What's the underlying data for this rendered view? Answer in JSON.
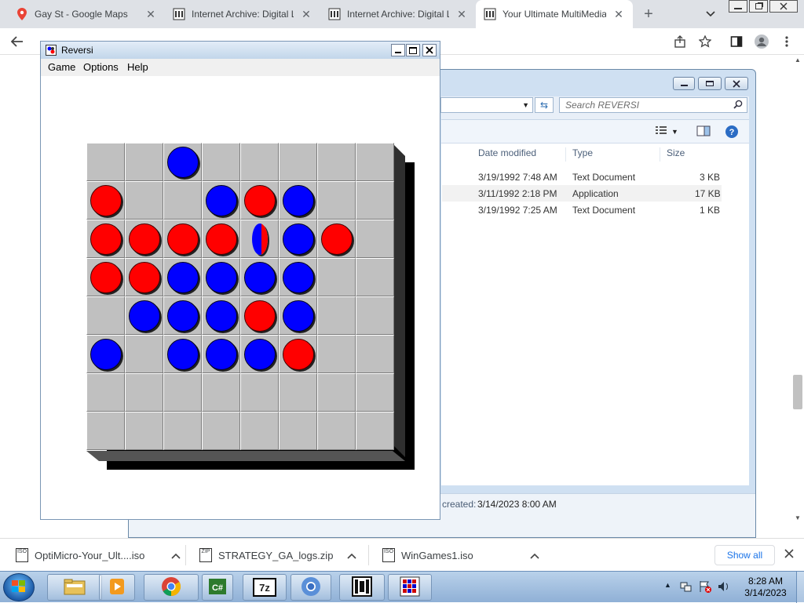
{
  "browser": {
    "tabs": [
      {
        "title": "Gay St - Google Maps",
        "icon": "google-maps-icon",
        "active": false
      },
      {
        "title": "Internet Archive: Digital L",
        "icon": "archive-icon",
        "active": false
      },
      {
        "title": "Internet Archive: Digital L",
        "icon": "archive-icon",
        "active": false
      },
      {
        "title": "Your Ultimate MultiMedia",
        "icon": "archive-icon",
        "active": true
      }
    ],
    "new_tab": "+",
    "close_glyph": "✕"
  },
  "explorer": {
    "search_placeholder": "Search REVERSI",
    "columns": [
      "Date modified",
      "Type",
      "Size"
    ],
    "rows": [
      {
        "date": "3/19/1992 7:48 AM",
        "type": "Text Document",
        "size": "3 KB"
      },
      {
        "date": "3/11/1992 2:18 PM",
        "type": "Application",
        "size": "17 KB"
      },
      {
        "date": "3/19/1992 7:25 AM",
        "type": "Text Document",
        "size": "1 KB"
      }
    ],
    "status_label": "created:",
    "status_value": "3/14/2023 8:00 AM"
  },
  "reversi": {
    "title": "Reversi",
    "menu": [
      "Game",
      "Options",
      "Help"
    ],
    "board": [
      [
        "",
        "",
        "B",
        "",
        "",
        "",
        "",
        ""
      ],
      [
        "R",
        "",
        "",
        "B",
        "R",
        "B",
        "",
        ""
      ],
      [
        "R",
        "R",
        "R",
        "R",
        "F",
        "B",
        "R",
        ""
      ],
      [
        "R",
        "R",
        "B",
        "B",
        "B",
        "B",
        "",
        ""
      ],
      [
        "",
        "B",
        "B",
        "B",
        "R",
        "B",
        "",
        ""
      ],
      [
        "B",
        "",
        "B",
        "B",
        "B",
        "R",
        "",
        ""
      ],
      [
        "",
        "",
        "",
        "",
        "",
        "",
        "",
        ""
      ],
      [
        "",
        "",
        "",
        "",
        "",
        "",
        "",
        ""
      ]
    ],
    "colors": {
      "red": "#ff0000",
      "blue": "#0000ff",
      "cell": "#c0c0c0"
    }
  },
  "downloads": {
    "items": [
      {
        "name": "OptiMicro-Your_Ult....iso",
        "icon": "iso-file-icon"
      },
      {
        "name": "STRATEGY_GA_logs.zip",
        "icon": "zip-file-icon"
      },
      {
        "name": "WinGames1.iso",
        "icon": "iso-file-icon"
      }
    ],
    "show_all": "Show all"
  },
  "taskbar": {
    "time": "8:28 AM",
    "date": "3/14/2023",
    "apps": [
      "file-explorer-icon",
      "media-player-icon",
      "chrome-icon",
      "csharp-icon",
      "7zip-icon",
      "chrome-canary-icon",
      "film-icon",
      "reversi-icon"
    ],
    "zip_label": "7z"
  }
}
